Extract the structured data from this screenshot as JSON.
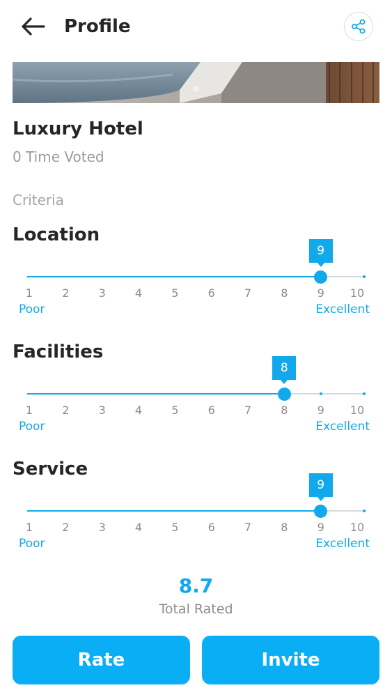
{
  "header": {
    "title": "Profile",
    "back_icon": "arrow-left-icon",
    "share_icon": "share-icon"
  },
  "banner": {
    "image": "hotel-photo",
    "carousel_dots": 1
  },
  "hotel": {
    "name": "Luxury Hotel",
    "votes": "0 Time Voted"
  },
  "criteria_heading": "Criteria",
  "scale": {
    "ticks": [
      "1",
      "2",
      "3",
      "4",
      "5",
      "6",
      "7",
      "8",
      "9",
      "10"
    ],
    "min_label": "Poor",
    "max_label": "Excellent"
  },
  "criteria": [
    {
      "name": "Location",
      "value": 9,
      "value_label": "9"
    },
    {
      "name": "Facilities",
      "value": 8,
      "value_label": "8"
    },
    {
      "name": "Service",
      "value": 9,
      "value_label": "9"
    }
  ],
  "total": {
    "value": "8.7",
    "label": "Total Rated"
  },
  "actions": {
    "rate_label": "Rate",
    "invite_label": "Invite"
  },
  "colors": {
    "accent": "#12a9ec",
    "button": "#0aaef5",
    "track": "#d4dbe0",
    "text": "#262626",
    "muted": "#9b9b9b"
  }
}
